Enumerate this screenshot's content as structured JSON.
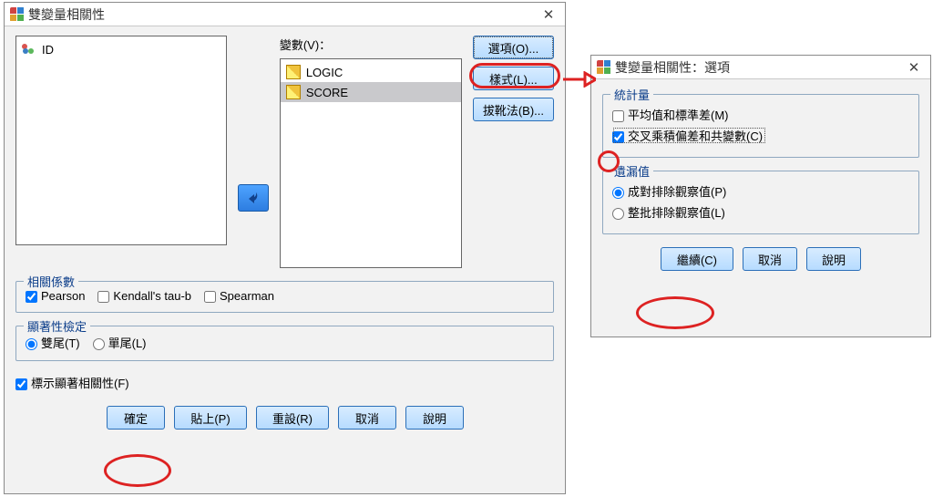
{
  "main": {
    "title": "雙變量相關性",
    "close": "✕",
    "left_list": [
      {
        "name": "ID",
        "type": "nominal"
      }
    ],
    "vars_header": "變數(V)：",
    "right_list": [
      {
        "name": "LOGIC",
        "type": "scale",
        "selected": false
      },
      {
        "name": "SCORE",
        "type": "scale",
        "selected": true
      }
    ],
    "side_buttons": {
      "options": "選項(O)...",
      "style": "樣式(L)...",
      "bootstrap": "拔靴法(B)..."
    },
    "coef": {
      "legend": "相關係數",
      "pearson": "Pearson",
      "kendall": "Kendall's tau-b",
      "spearman": "Spearman"
    },
    "sig": {
      "legend": "顯著性檢定",
      "twotail": "雙尾(T)",
      "onetail": "單尾(L)"
    },
    "flag": "標示顯著相關性(F)",
    "buttons": {
      "ok": "確定",
      "paste": "貼上(P)",
      "reset": "重設(R)",
      "cancel": "取消",
      "help": "說明"
    }
  },
  "opts": {
    "title": "雙變量相關性：選項",
    "close": "✕",
    "stats": {
      "legend": "統計量",
      "means": "平均值和標準差(M)",
      "cross": "交叉乘積偏差和共變數(C)"
    },
    "missing": {
      "legend": "遺漏值",
      "pairwise": "成對排除觀察值(P)",
      "listwise": "整批排除觀察值(L)"
    },
    "buttons": {
      "continue": "繼續(C)",
      "cancel": "取消",
      "help": "說明"
    }
  }
}
